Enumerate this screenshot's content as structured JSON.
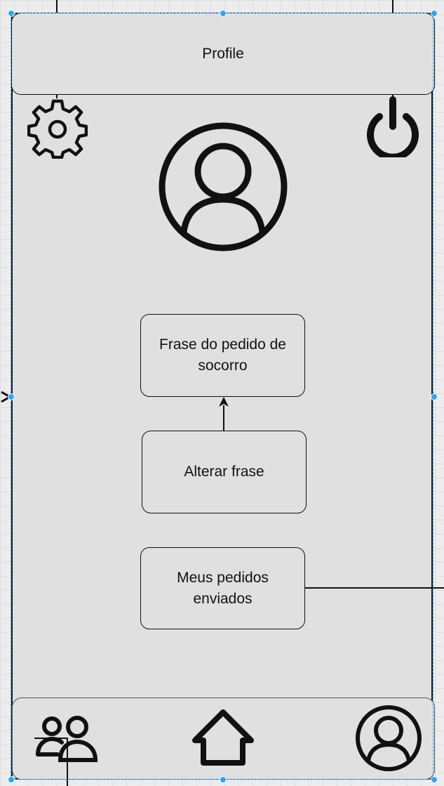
{
  "header": {
    "title": "Profile"
  },
  "boxes": {
    "phrase": "Frase do pedido de socorro",
    "change_phrase": "Alterar frase",
    "my_requests": "Meus pedidos enviados"
  },
  "icons": {
    "settings": "gear-icon",
    "power": "power-icon",
    "profile_avatar": "user-circle-icon",
    "nav_contacts": "people-icon",
    "nav_home": "home-icon",
    "nav_profile": "user-circle-icon"
  },
  "colors": {
    "stroke": "#111111",
    "fill": "#e0e0e0",
    "selection": "#29a8ff"
  }
}
